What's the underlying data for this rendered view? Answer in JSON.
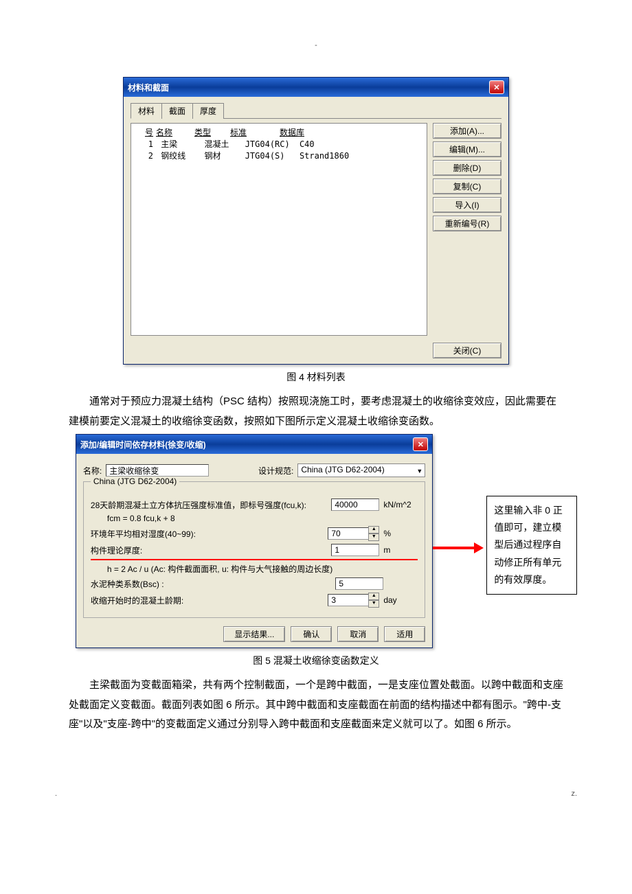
{
  "pageHeader": "-",
  "pageFooterLeft": ".",
  "pageFooterRight": "z.",
  "dialog1": {
    "title": "材料和截面",
    "tabs": {
      "t1": "材料",
      "t2": "截面",
      "t3": "厚度"
    },
    "cols": {
      "num": "号",
      "name": "名称",
      "type": "类型",
      "std": "标准",
      "db": "数据库"
    },
    "rows": [
      {
        "num": "1",
        "name": "主梁",
        "type": "混凝土",
        "std": "JTG04(RC)",
        "db": "C40"
      },
      {
        "num": "2",
        "name": "钢绞线",
        "type": "钢材",
        "std": "JTG04(S)",
        "db": "Strand1860"
      }
    ],
    "btns": {
      "add": "添加(A)...",
      "edit": "编辑(M)...",
      "del": "删除(D)",
      "copy": "复制(C)",
      "imp": "导入(I)",
      "renum": "重新编号(R)"
    },
    "close": "关闭(C)"
  },
  "caption1": "图 4  材料列表",
  "para1": "通常对于预应力混凝土结构（PSC 结构）按照现浇施工时，要考虑混凝土的收缩徐变效应，因此需要在建模前要定义混凝土的收缩徐变函数，按照如下图所示定义混凝土收缩徐变函数。",
  "dialog2": {
    "title": "添加/编辑时间依存材料(徐变/收缩)",
    "nameLabel": "名称:",
    "nameValue": "主梁收缩徐变",
    "codeLabel": "设计规范:",
    "codeValue": "China (JTG D62-2004)",
    "group": "China (JTG D62-2004)",
    "f1": "28天龄期混凝土立方体抗压强度标准值，即标号强度(fcu,k):",
    "f1val": "40000",
    "f1unit": "kN/m^2",
    "fcm": "fcm = 0.8 fcu,k + 8",
    "f2": "环境年平均相对湿度(40~99):",
    "f2val": "70",
    "f2unit": "%",
    "f3": "构件理论厚度:",
    "f3val": "1",
    "f3unit": "m",
    "hnote": "h = 2 Ac / u  (Ac: 构件截面面积,  u: 构件与大气接触的周边长度)",
    "f4": "水泥种类系数(Bsc) :",
    "f4val": "5",
    "f5": "收缩开始时的混凝土龄期:",
    "f5val": "3",
    "f5unit": "day",
    "btns": {
      "show": "显示结果...",
      "ok": "确认",
      "cancel": "取消",
      "apply": "适用"
    }
  },
  "caption2": "图 5  混凝土收缩徐变函数定义",
  "annotation": "这里输入非 0 正值即可，建立模型后通过程序自动修正所有单元的有效厚度。",
  "para2": "主梁截面为变截面箱梁，共有两个控制截面，一个是跨中截面，一是支座位置处截面。以跨中截面和支座处截面定义变截面。截面列表如图 6 所示。其中跨中截面和支座截面在前面的结构描述中都有图示。\"跨中-支座\"以及\"支座-跨中\"的变截面定义通过分别导入跨中截面和支座截面来定义就可以了。如图 6 所示。"
}
